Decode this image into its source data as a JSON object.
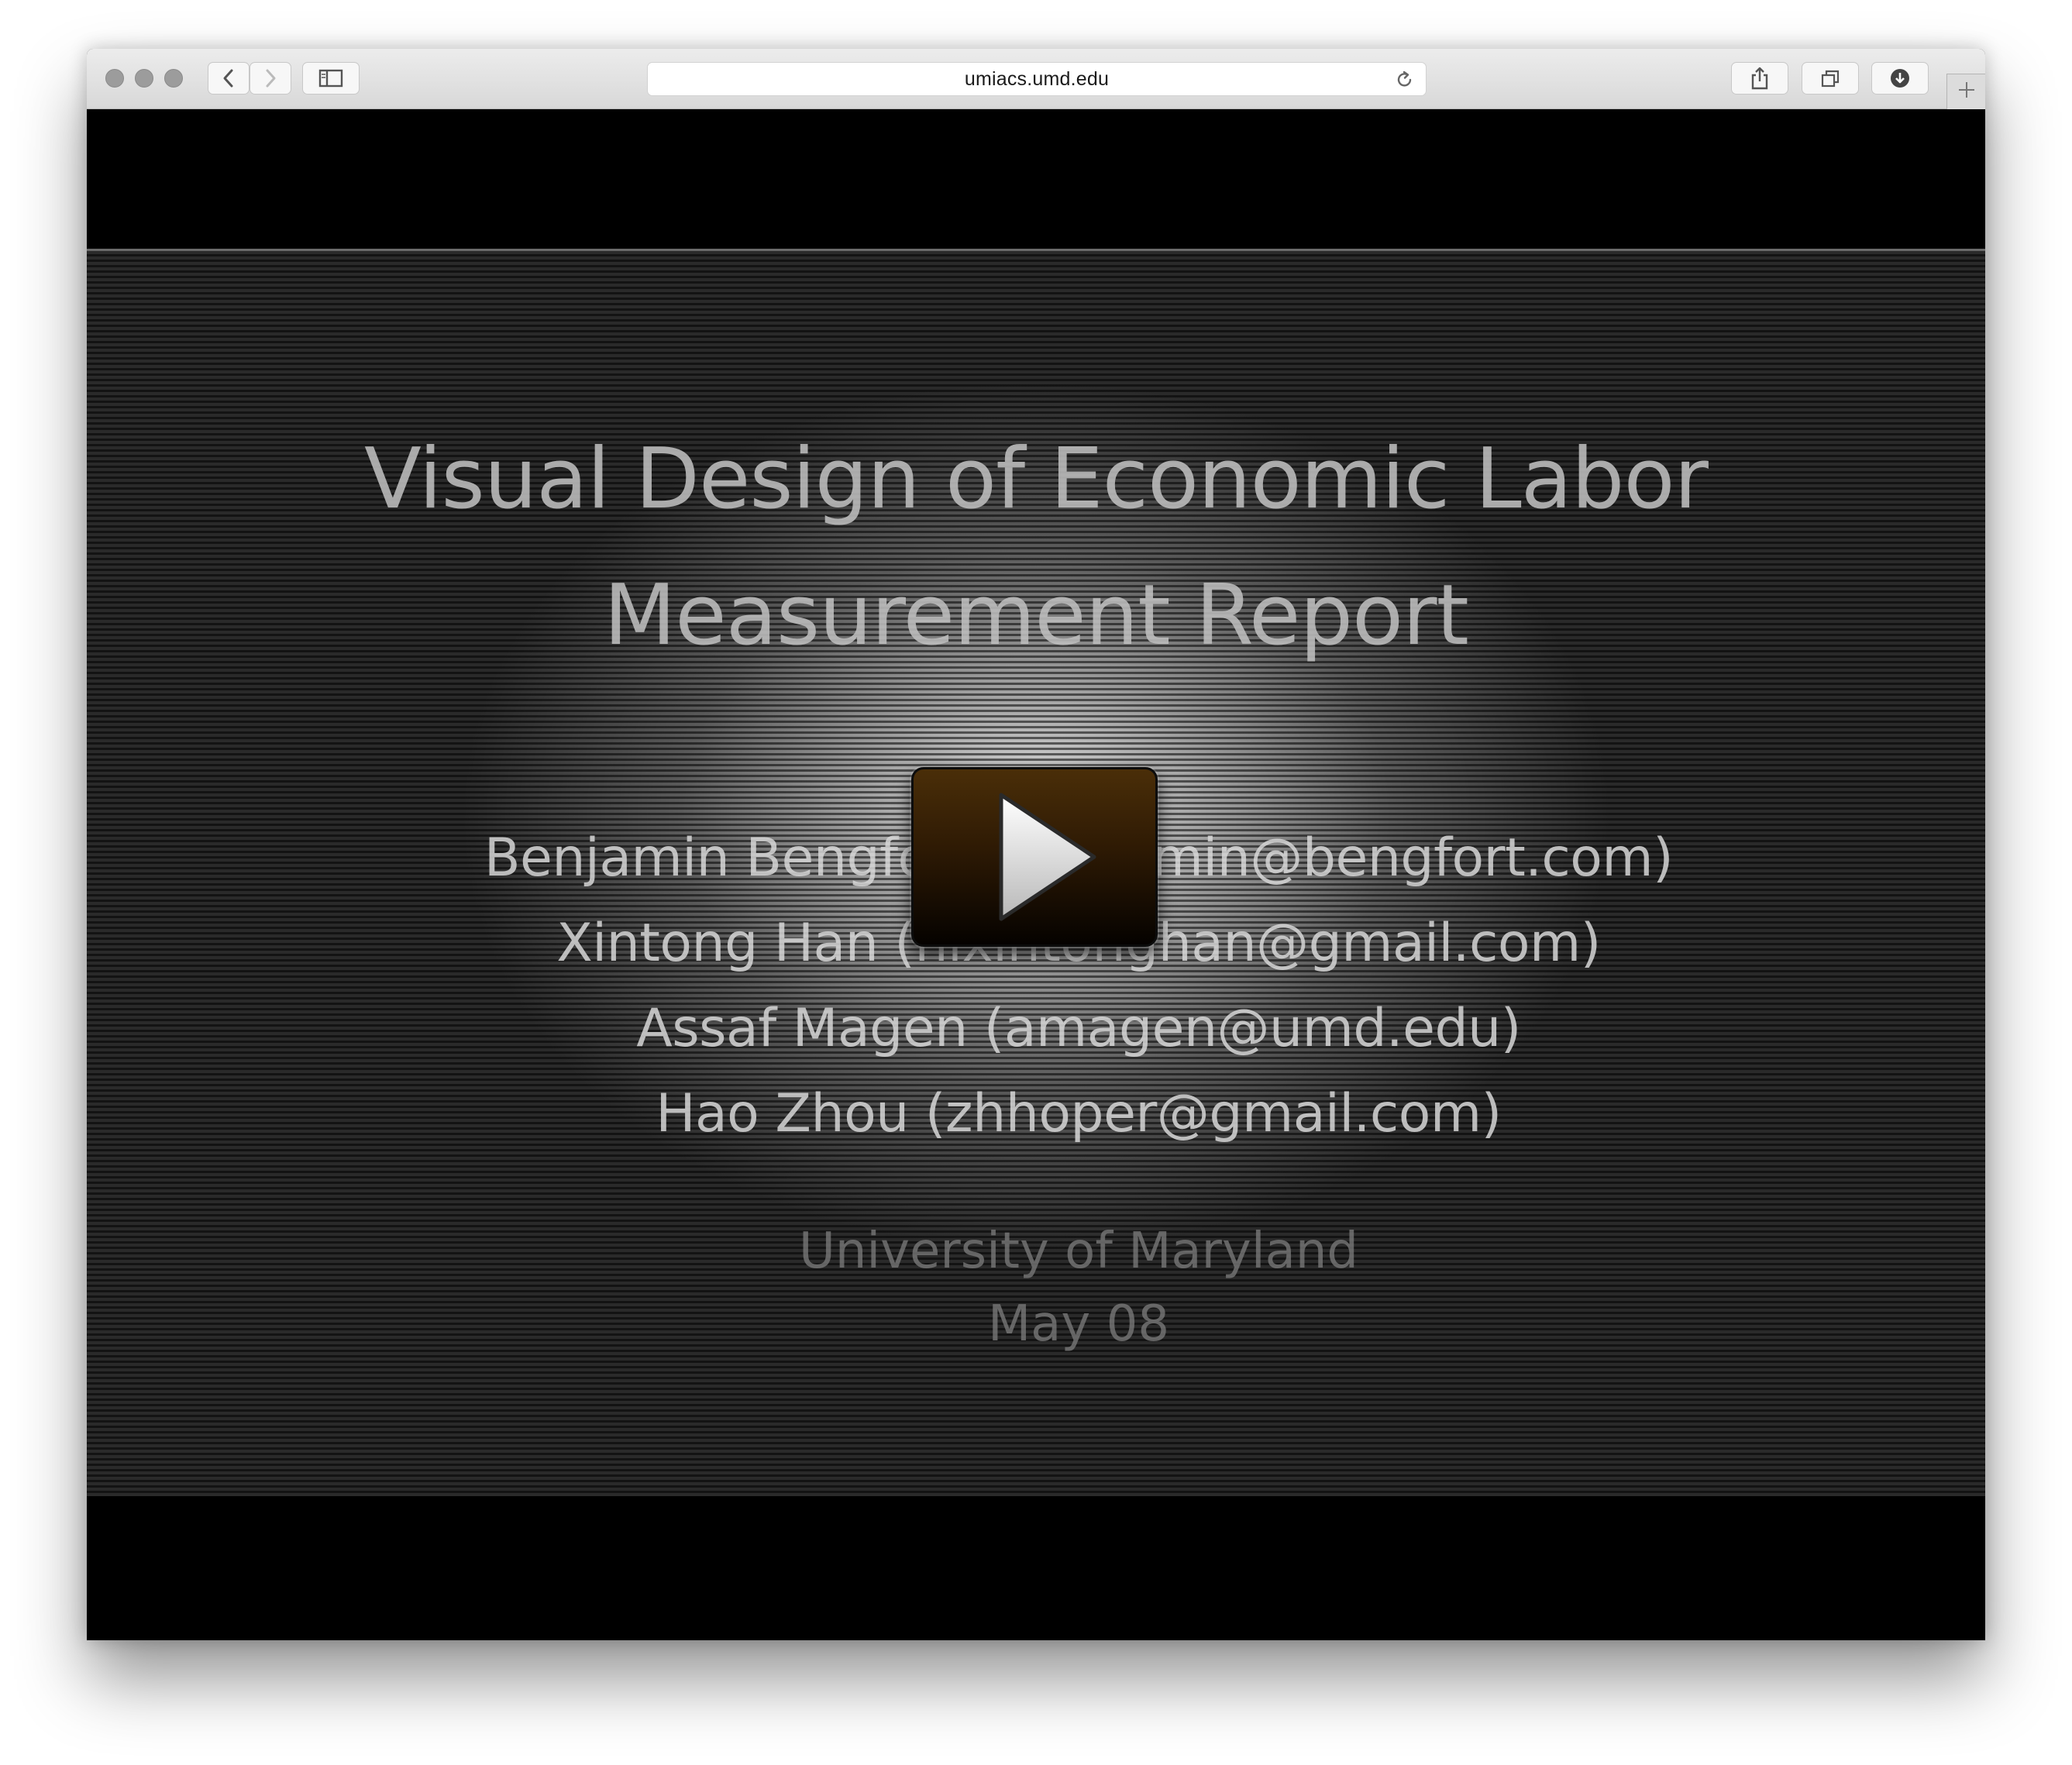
{
  "browser": {
    "url": "umiacs.umd.edu",
    "icons": {
      "back": "chevron-left-icon",
      "forward": "chevron-right-icon",
      "sidebar": "sidebar-icon",
      "reload": "reload-icon",
      "share": "share-icon",
      "tabs": "tabs-overview-icon",
      "downloads": "download-icon",
      "new_tab": "plus-icon"
    }
  },
  "slide": {
    "title_line1": "Visual Design of Economic Labor",
    "title_line2": "Measurement Report",
    "authors": [
      "Benjamin Bengfort (benjamin@bengfort.com)",
      "Xintong Han (hixintonghan@gmail.com)",
      "Assaf Magen (amagen@umd.edu)",
      "Hao Zhou (zhhoper@gmail.com)"
    ],
    "institution": "University of Maryland",
    "date": "May 08"
  },
  "video": {
    "play_icon": "play-icon"
  },
  "colors": {
    "background": "#000000",
    "toolbar": "#e2e2e2",
    "play_button": "#3a2406"
  }
}
